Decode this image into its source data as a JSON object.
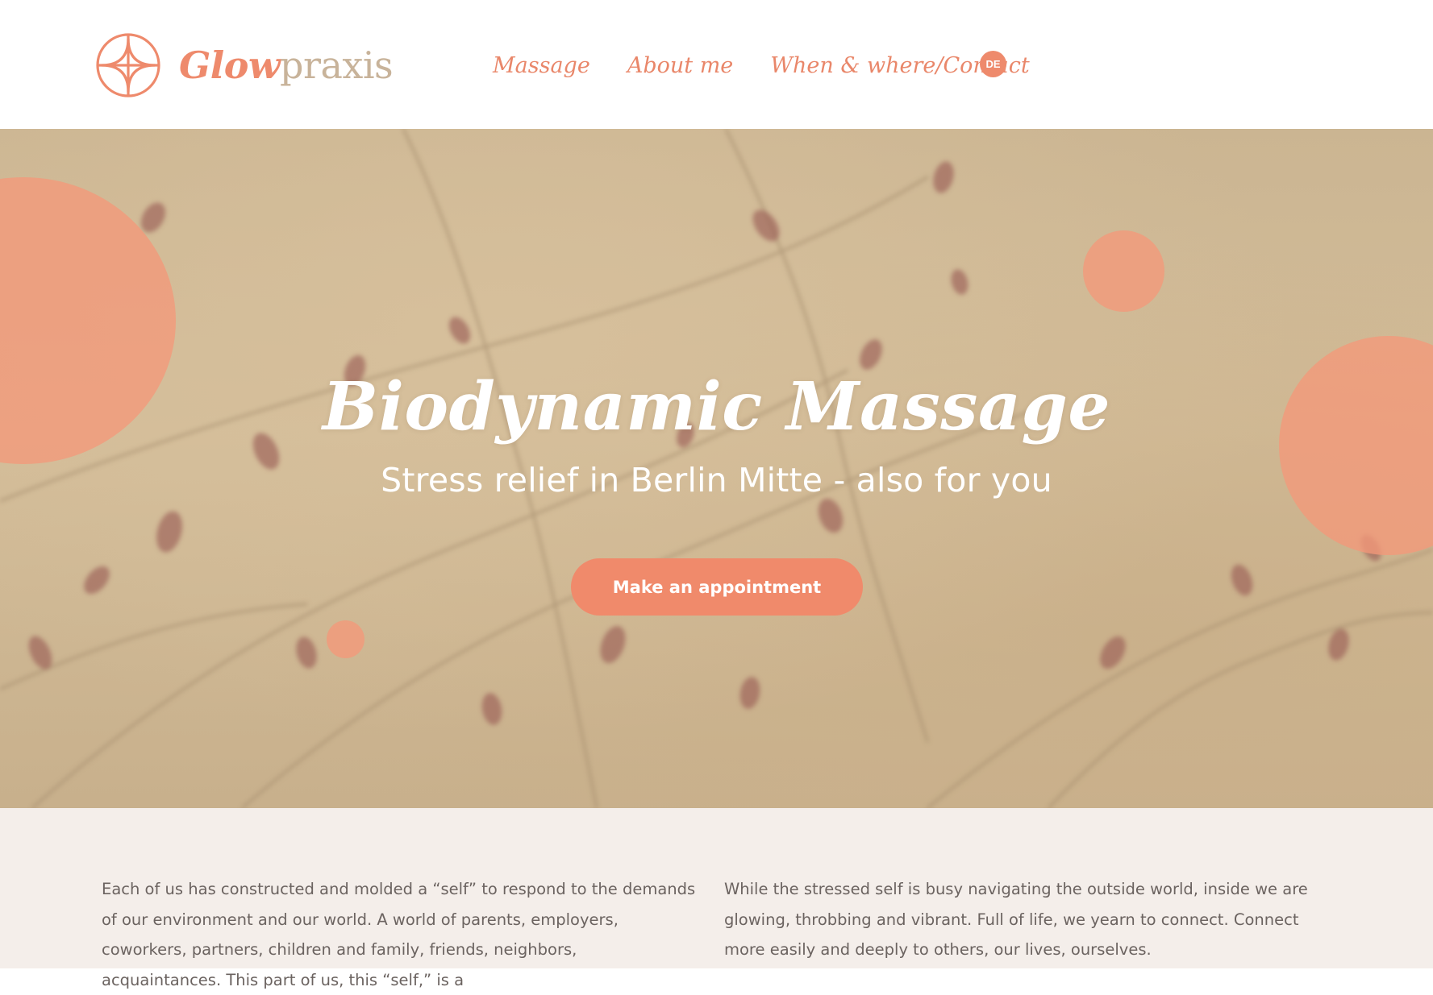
{
  "brand": {
    "strong": "Glow",
    "light": "praxis"
  },
  "nav": {
    "items": [
      {
        "label": "Massage"
      },
      {
        "label": "About me"
      },
      {
        "label": "When & where/Contact"
      }
    ],
    "language": "DE"
  },
  "hero": {
    "title": "Biodynamic Massage",
    "subtitle": "Stress relief in Berlin Mitte - also for you",
    "cta_label": "Make an appointment"
  },
  "intro": {
    "left": "Each of us has constructed and molded a “self” to respond to the demands of our environment and our world. A world of parents, employers, coworkers, partners, children and family, friends, neighbors, acquaintances. This part of us, this “self,” is a",
    "right": "While the stressed self is busy navigating the outside world, inside we are glowing, throbbing and vibrant. Full of life, we yearn to connect. Connect more easily and deeply to others, our lives, ourselves."
  },
  "colors": {
    "accent": "#ee8a6c",
    "brand_light": "#c8b39a",
    "hero_bg": "#cfb894",
    "intro_bg": "#f4eeea",
    "body_text": "#6b6360"
  },
  "icons": {
    "logo": "glowpraxis-logo-mark"
  }
}
